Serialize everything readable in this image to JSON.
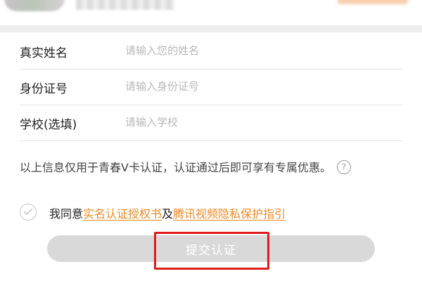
{
  "form": {
    "fields": [
      {
        "label": "真实姓名",
        "placeholder": "请输入您的姓名",
        "value": ""
      },
      {
        "label": "身份证号",
        "placeholder": "请输入身份证号",
        "value": ""
      },
      {
        "label": "学校(选填)",
        "placeholder": "请输入学校",
        "value": ""
      }
    ]
  },
  "notice": {
    "text": "以上信息仅用于青春V卡认证，认证通过后即可享有专属优惠。",
    "help_icon": "?"
  },
  "agreement": {
    "prefix": "我同意",
    "link1": "实名认证授权书",
    "connector": "及",
    "link2": "腾讯视频隐私保护指引",
    "checked": false
  },
  "submit": {
    "label": "提交认证"
  },
  "colors": {
    "link": "#f08a24",
    "button_bg": "#d9d9d9",
    "highlight": "#e11b1b"
  }
}
